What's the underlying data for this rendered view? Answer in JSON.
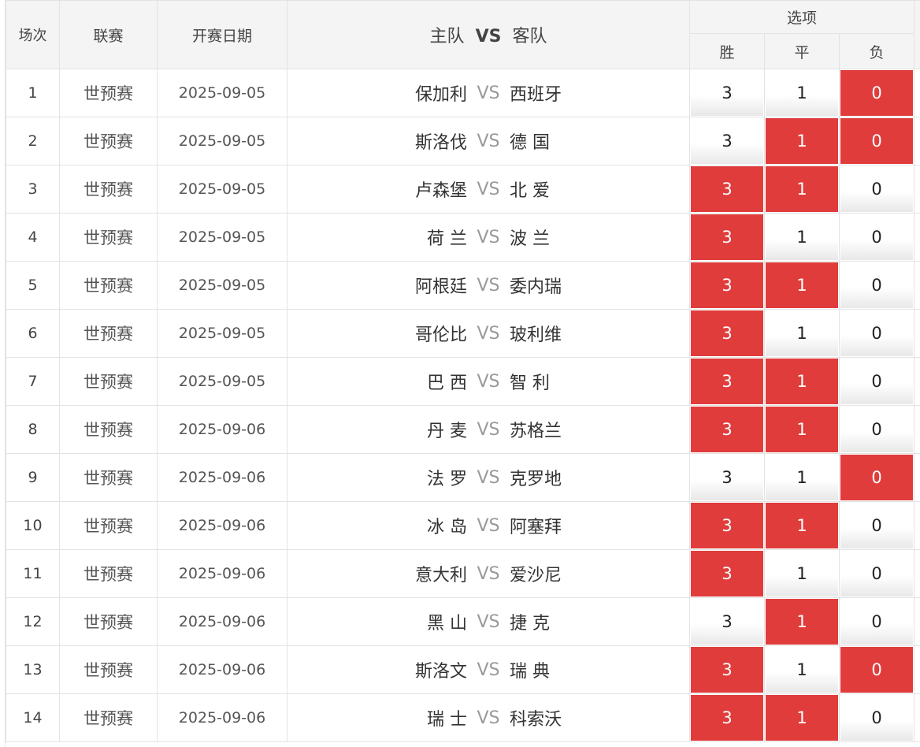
{
  "header": {
    "col_index": "场次",
    "col_league": "联赛",
    "col_date": "开赛日期",
    "col_home": "主队",
    "col_vs": "VS",
    "col_away": "客队",
    "col_options": "选项",
    "opt_win": "胜",
    "opt_draw": "平",
    "opt_lose": "负"
  },
  "vs_label": "VS",
  "colors": {
    "selected": "#e03c3c",
    "border": "#e3e3e3",
    "header_bg": "#f4f4f4"
  },
  "rows": [
    {
      "index": "1",
      "league": "世预赛",
      "date": "2025-09-05",
      "home": "保加利",
      "away": "西班牙",
      "win": "3",
      "draw": "1",
      "lose": "0",
      "win_sel": false,
      "draw_sel": false,
      "lose_sel": true
    },
    {
      "index": "2",
      "league": "世预赛",
      "date": "2025-09-05",
      "home": "斯洛伐",
      "away": "德 国",
      "win": "3",
      "draw": "1",
      "lose": "0",
      "win_sel": false,
      "draw_sel": true,
      "lose_sel": true
    },
    {
      "index": "3",
      "league": "世预赛",
      "date": "2025-09-05",
      "home": "卢森堡",
      "away": "北 爱",
      "win": "3",
      "draw": "1",
      "lose": "0",
      "win_sel": true,
      "draw_sel": true,
      "lose_sel": false
    },
    {
      "index": "4",
      "league": "世预赛",
      "date": "2025-09-05",
      "home": "荷 兰",
      "away": "波 兰",
      "win": "3",
      "draw": "1",
      "lose": "0",
      "win_sel": true,
      "draw_sel": false,
      "lose_sel": false
    },
    {
      "index": "5",
      "league": "世预赛",
      "date": "2025-09-05",
      "home": "阿根廷",
      "away": "委内瑞",
      "win": "3",
      "draw": "1",
      "lose": "0",
      "win_sel": true,
      "draw_sel": true,
      "lose_sel": false
    },
    {
      "index": "6",
      "league": "世预赛",
      "date": "2025-09-05",
      "home": "哥伦比",
      "away": "玻利维",
      "win": "3",
      "draw": "1",
      "lose": "0",
      "win_sel": true,
      "draw_sel": false,
      "lose_sel": false
    },
    {
      "index": "7",
      "league": "世预赛",
      "date": "2025-09-05",
      "home": "巴 西",
      "away": "智 利",
      "win": "3",
      "draw": "1",
      "lose": "0",
      "win_sel": true,
      "draw_sel": true,
      "lose_sel": false
    },
    {
      "index": "8",
      "league": "世预赛",
      "date": "2025-09-06",
      "home": "丹 麦",
      "away": "苏格兰",
      "win": "3",
      "draw": "1",
      "lose": "0",
      "win_sel": true,
      "draw_sel": true,
      "lose_sel": false
    },
    {
      "index": "9",
      "league": "世预赛",
      "date": "2025-09-06",
      "home": "法 罗",
      "away": "克罗地",
      "win": "3",
      "draw": "1",
      "lose": "0",
      "win_sel": false,
      "draw_sel": false,
      "lose_sel": true
    },
    {
      "index": "10",
      "league": "世预赛",
      "date": "2025-09-06",
      "home": "冰 岛",
      "away": "阿塞拜",
      "win": "3",
      "draw": "1",
      "lose": "0",
      "win_sel": true,
      "draw_sel": true,
      "lose_sel": false
    },
    {
      "index": "11",
      "league": "世预赛",
      "date": "2025-09-06",
      "home": "意大利",
      "away": "爱沙尼",
      "win": "3",
      "draw": "1",
      "lose": "0",
      "win_sel": true,
      "draw_sel": false,
      "lose_sel": false
    },
    {
      "index": "12",
      "league": "世预赛",
      "date": "2025-09-06",
      "home": "黑 山",
      "away": "捷 克",
      "win": "3",
      "draw": "1",
      "lose": "0",
      "win_sel": false,
      "draw_sel": true,
      "lose_sel": false
    },
    {
      "index": "13",
      "league": "世预赛",
      "date": "2025-09-06",
      "home": "斯洛文",
      "away": "瑞 典",
      "win": "3",
      "draw": "1",
      "lose": "0",
      "win_sel": true,
      "draw_sel": false,
      "lose_sel": true
    },
    {
      "index": "14",
      "league": "世预赛",
      "date": "2025-09-06",
      "home": "瑞 士",
      "away": "科索沃",
      "win": "3",
      "draw": "1",
      "lose": "0",
      "win_sel": true,
      "draw_sel": true,
      "lose_sel": false
    }
  ]
}
